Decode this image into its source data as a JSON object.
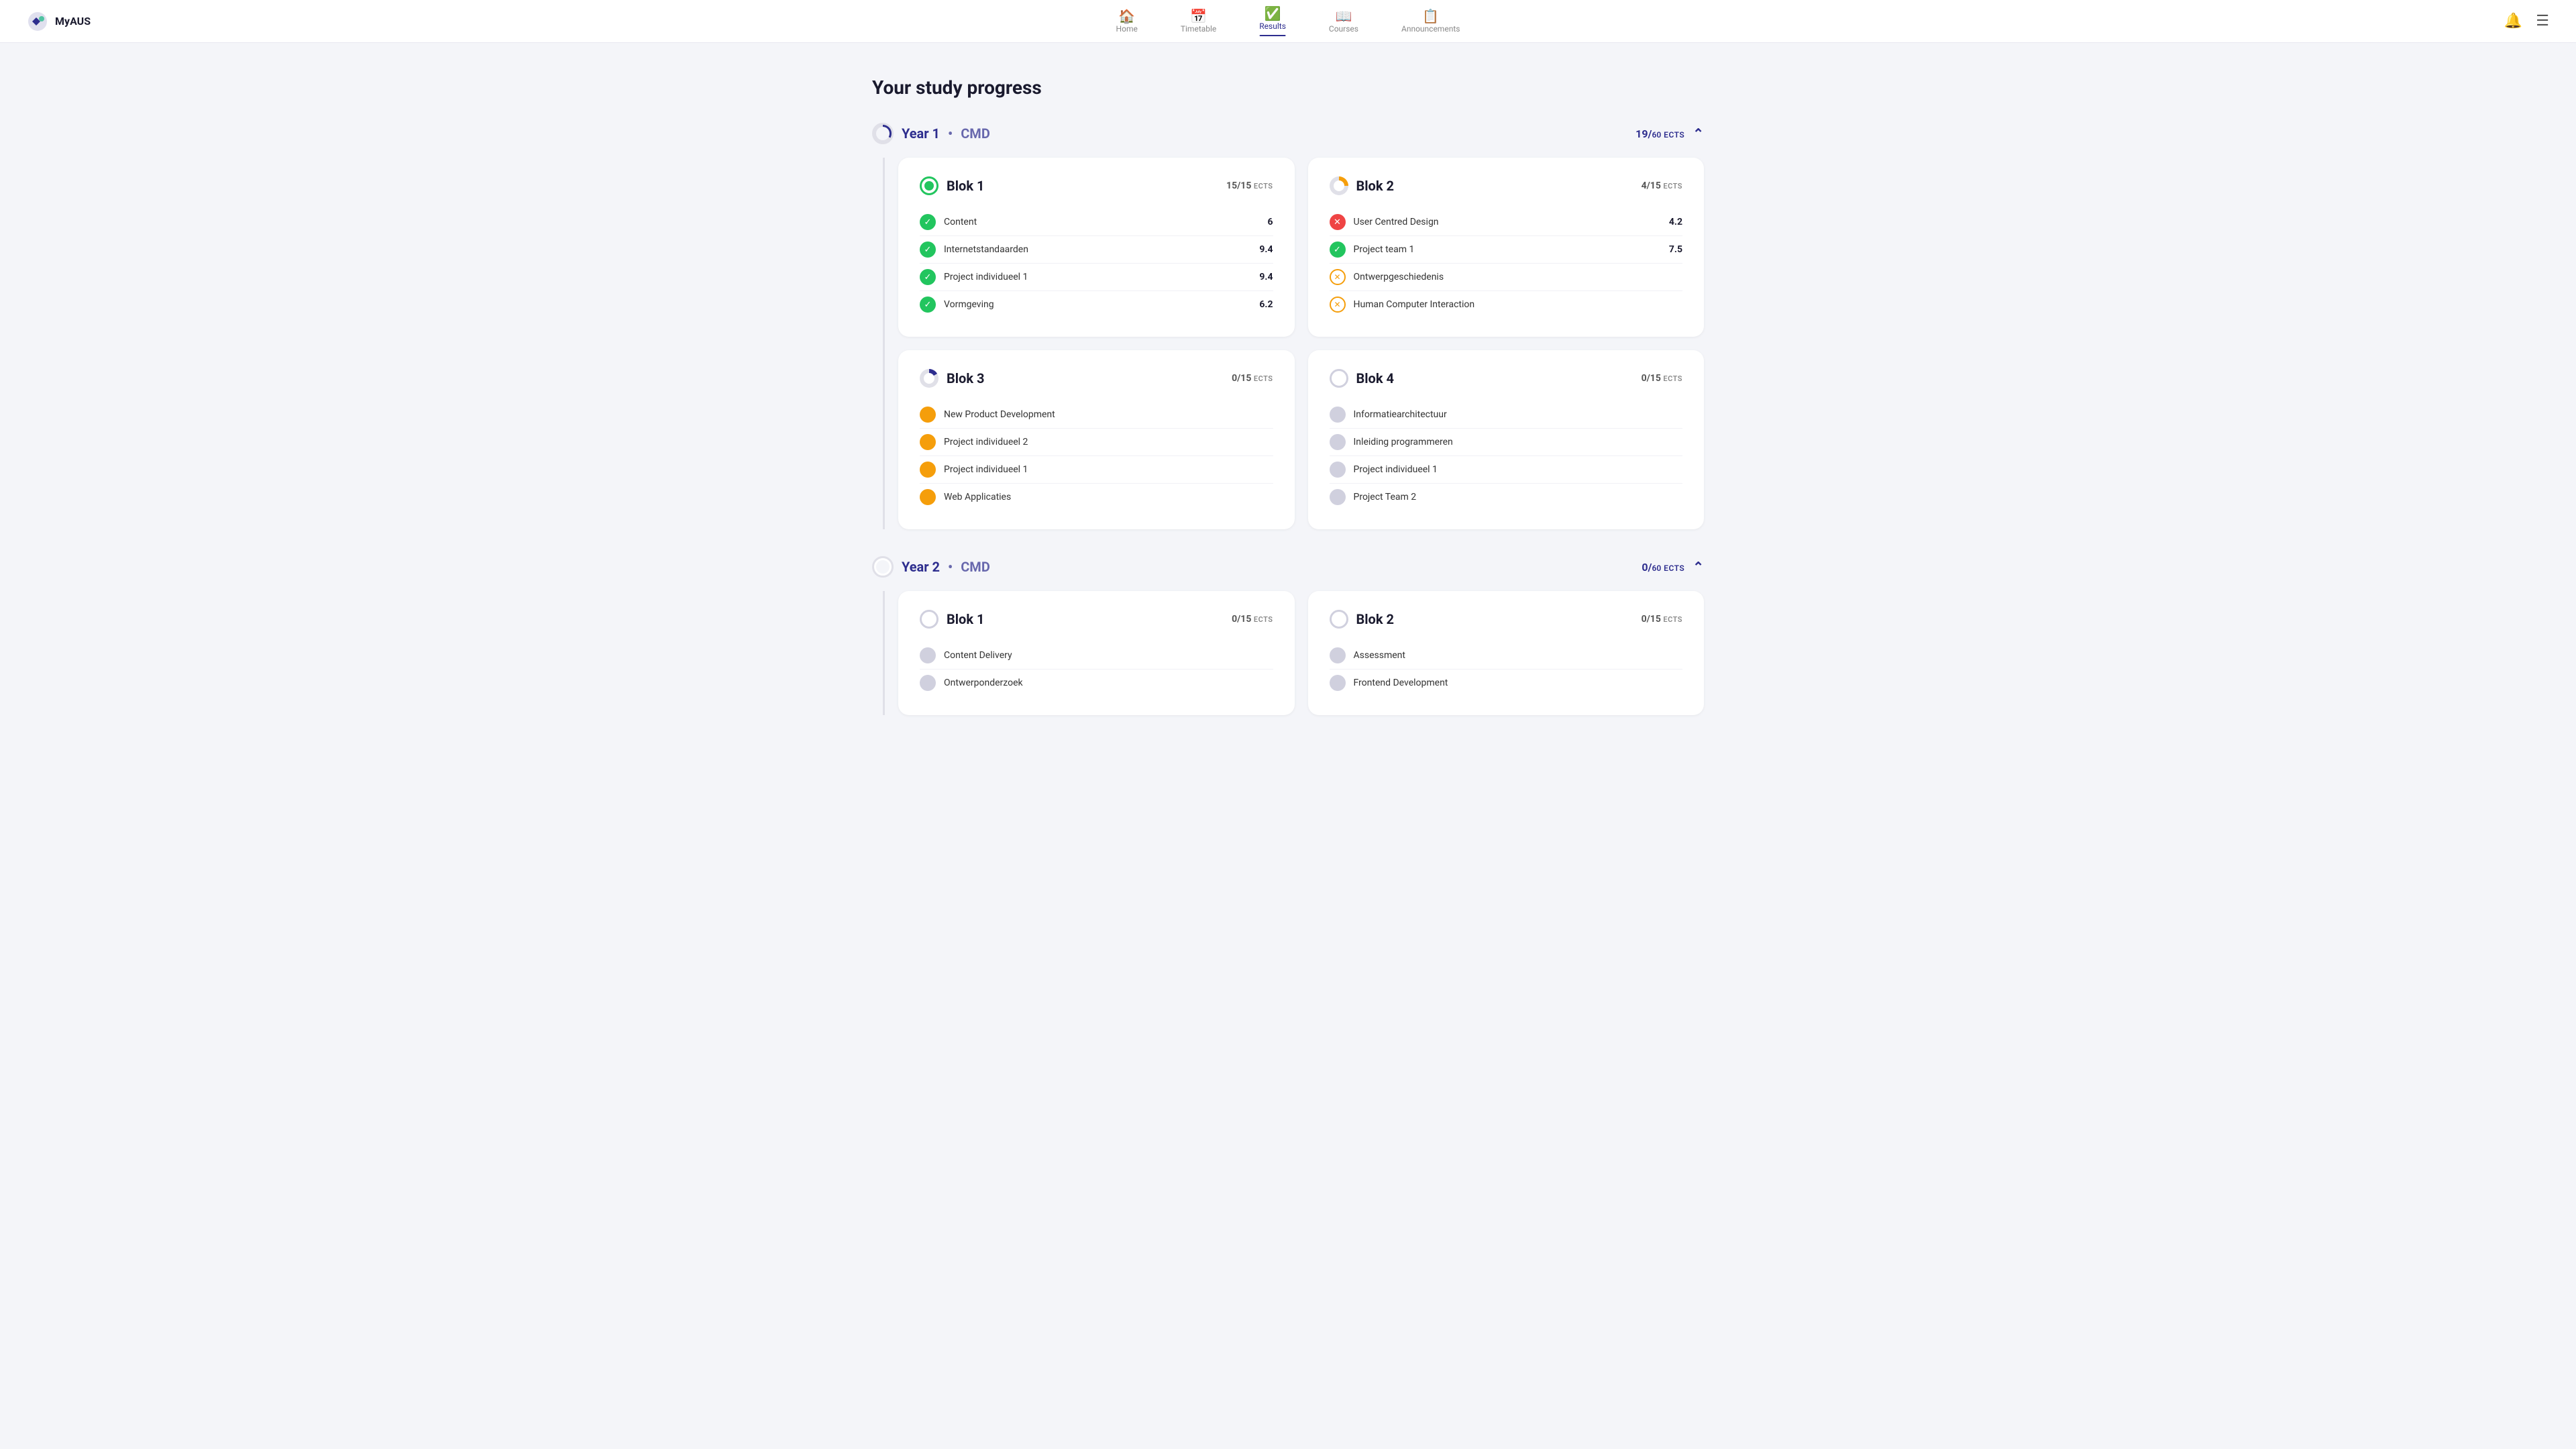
{
  "header": {
    "logo_text": "MyAUS",
    "nav_items": [
      {
        "id": "home",
        "label": "Home",
        "icon": "🏠",
        "active": false
      },
      {
        "id": "timetable",
        "label": "Timetable",
        "icon": "📅",
        "active": false
      },
      {
        "id": "results",
        "label": "Results",
        "icon": "✅",
        "active": true
      },
      {
        "id": "courses",
        "label": "Courses",
        "icon": "📖",
        "active": false
      },
      {
        "id": "announcements",
        "label": "Announcements",
        "icon": "📋",
        "active": false
      }
    ]
  },
  "page_title": "Your study progress",
  "years": [
    {
      "id": "year1",
      "label": "Year 1",
      "separator": "•",
      "program": "CMD",
      "ects_earned": "19",
      "ects_total": "60",
      "ects_label": "ECTS",
      "circle_type": "partial",
      "bloks": [
        {
          "id": "blok1",
          "label": "Blok 1",
          "ects_earned": "15",
          "ects_total": "15",
          "ects_suffix": "ECTS",
          "circle_type": "complete",
          "courses": [
            {
              "name": "Content",
              "grade": "6",
              "status": "check"
            },
            {
              "name": "Internetstandaarden",
              "grade": "9.4",
              "status": "check"
            },
            {
              "name": "Project individueel 1",
              "grade": "9.4",
              "status": "check"
            },
            {
              "name": "Vormgeving",
              "grade": "6.2",
              "status": "check"
            }
          ]
        },
        {
          "id": "blok2",
          "label": "Blok 2",
          "ects_earned": "4",
          "ects_total": "15",
          "ects_suffix": "ECTS",
          "circle_type": "partial_orange",
          "courses": [
            {
              "name": "User Centred Design",
              "grade": "4.2",
              "status": "x"
            },
            {
              "name": "Project team 1",
              "grade": "7.5",
              "status": "check"
            },
            {
              "name": "Ontwerpgeschiedenis",
              "grade": "",
              "status": "star"
            },
            {
              "name": "Human Computer Interaction",
              "grade": "",
              "status": "star"
            }
          ]
        },
        {
          "id": "blok3",
          "label": "Blok 3",
          "ects_earned": "0",
          "ects_total": "15",
          "ects_suffix": "ECTS",
          "circle_type": "loading",
          "courses": [
            {
              "name": "New Product Development",
              "grade": "",
              "status": "yellow"
            },
            {
              "name": "Project individueel 2",
              "grade": "",
              "status": "yellow"
            },
            {
              "name": "Project individueel 1",
              "grade": "",
              "status": "yellow"
            },
            {
              "name": "Web Applicaties",
              "grade": "",
              "status": "yellow"
            }
          ]
        },
        {
          "id": "blok4",
          "label": "Blok 4",
          "ects_earned": "0",
          "ects_total": "15",
          "ects_suffix": "ECTS",
          "circle_type": "empty",
          "courses": [
            {
              "name": "Informatiearchitectuur",
              "grade": "",
              "status": "gray"
            },
            {
              "name": "Inleiding programmeren",
              "grade": "",
              "status": "gray"
            },
            {
              "name": "Project individueel 1",
              "grade": "",
              "status": "gray"
            },
            {
              "name": "Project Team 2",
              "grade": "",
              "status": "gray"
            }
          ]
        }
      ]
    },
    {
      "id": "year2",
      "label": "Year 2",
      "separator": "•",
      "program": "CMD",
      "ects_earned": "0",
      "ects_total": "60",
      "ects_label": "ECTS",
      "circle_type": "empty",
      "bloks": [
        {
          "id": "blok1",
          "label": "Blok 1",
          "ects_earned": "0",
          "ects_total": "15",
          "ects_suffix": "ECTS",
          "circle_type": "empty",
          "courses": [
            {
              "name": "Content Delivery",
              "grade": "",
              "status": "gray"
            },
            {
              "name": "Ontwerponderzoek",
              "grade": "",
              "status": "gray"
            }
          ]
        },
        {
          "id": "blok2",
          "label": "Blok 2",
          "ects_earned": "0",
          "ects_total": "15",
          "ects_suffix": "ECTS",
          "circle_type": "empty",
          "courses": [
            {
              "name": "Assessment",
              "grade": "",
              "status": "gray"
            },
            {
              "name": "Frontend Development",
              "grade": "",
              "status": "gray"
            }
          ]
        }
      ]
    }
  ]
}
